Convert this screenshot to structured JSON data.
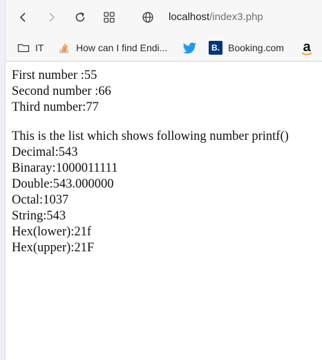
{
  "browser": {
    "address_host": "localhost",
    "address_path": "/index3.php",
    "bookmarks": [
      {
        "label": "IT",
        "icon": "folder-icon"
      },
      {
        "label": "How can I find Endi...",
        "icon": "stackoverflow-icon"
      },
      {
        "label": "",
        "icon": "twitter-icon"
      },
      {
        "label": "Booking.com",
        "icon": "booking-icon"
      },
      {
        "label": "",
        "icon": "amazon-icon"
      }
    ],
    "booking_badge": "B.",
    "amazon_badge": "a"
  },
  "page": {
    "numbers": [
      "First number :55",
      "Second number :66",
      "Third number:77"
    ],
    "list_heading": "This is the list which shows following number printf()",
    "formats": [
      "Decimal:543",
      "Binaray:1000011111",
      "Double:543.000000",
      "Octal:1037",
      "String:543",
      "Hex(lower):21f",
      "Hex(upper):21F"
    ]
  },
  "colors": {
    "twitter": "#1d9bf0",
    "booking": "#003580",
    "stackoverflow": "#f48024"
  }
}
